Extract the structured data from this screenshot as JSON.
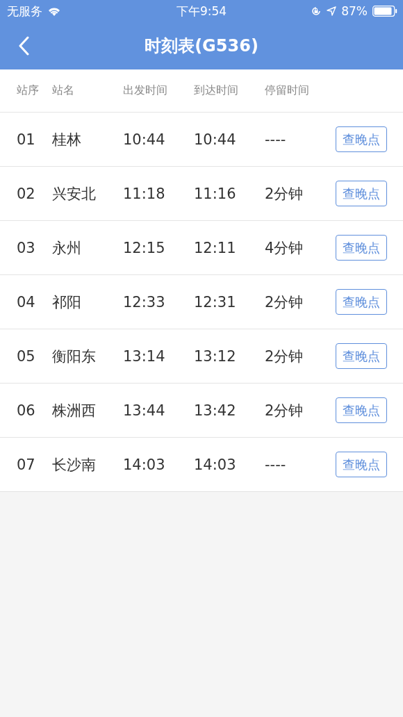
{
  "status_bar": {
    "carrier": "无服务",
    "time": "下午9:54",
    "battery": "87%"
  },
  "nav": {
    "title": "时刻表(G536)"
  },
  "table": {
    "columns": [
      "站序",
      "站名",
      "出发时间",
      "到达时间",
      "停留时间"
    ],
    "rows": [
      {
        "cells": [
          "01",
          "桂林",
          "10:44",
          "10:44",
          "----"
        ],
        "action": "查晚点"
      },
      {
        "cells": [
          "02",
          "兴安北",
          "11:18",
          "11:16",
          "2分钟"
        ],
        "action": "查晚点"
      },
      {
        "cells": [
          "03",
          "永州",
          "12:15",
          "12:11",
          "4分钟"
        ],
        "action": "查晚点"
      },
      {
        "cells": [
          "04",
          "祁阳",
          "12:33",
          "12:31",
          "2分钟"
        ],
        "action": "查晚点"
      },
      {
        "cells": [
          "05",
          "衡阳东",
          "13:14",
          "13:12",
          "2分钟"
        ],
        "action": "查晚点"
      },
      {
        "cells": [
          "06",
          "株洲西",
          "13:44",
          "13:42",
          "2分钟"
        ],
        "action": "查晚点"
      },
      {
        "cells": [
          "07",
          "长沙南",
          "14:03",
          "14:03",
          "----"
        ],
        "action": "查晚点"
      }
    ]
  }
}
